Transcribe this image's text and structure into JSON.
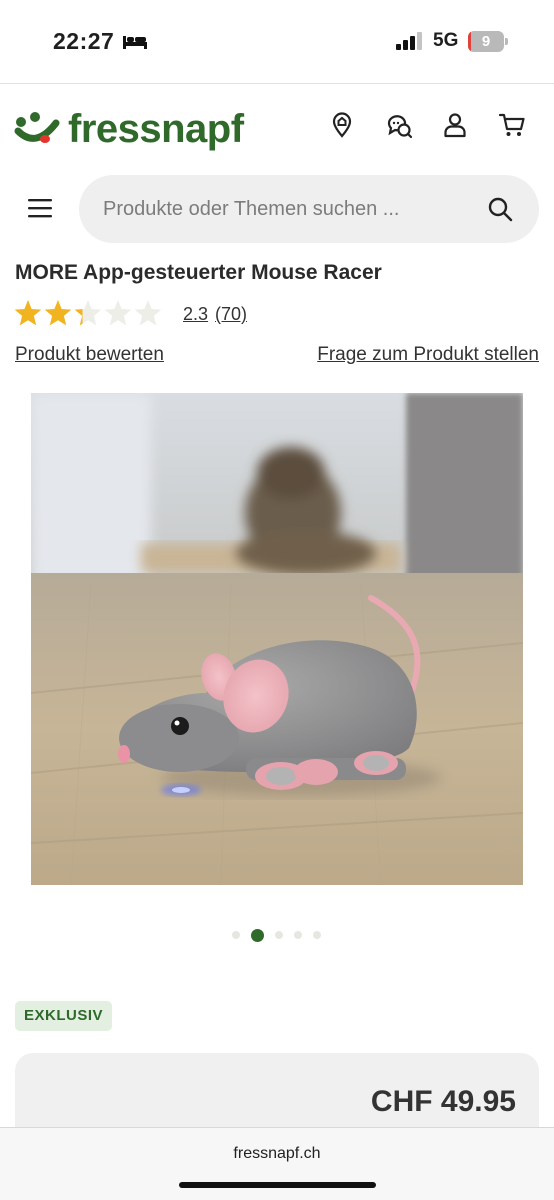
{
  "status_bar": {
    "time": "22:27",
    "network": "5G",
    "battery": "9",
    "battery_level": 0.09
  },
  "header": {
    "logo_text": "fressnapf",
    "icons": [
      "location-pin-icon",
      "chat-support-icon",
      "user-icon",
      "cart-icon"
    ],
    "brand_color": "#2f6a2a"
  },
  "search": {
    "placeholder": "Produkte oder Themen suchen ..."
  },
  "product": {
    "title": "MORE App-gesteuerter Mouse Racer",
    "rating_value": "2.3",
    "rating_count": "(70)",
    "rating_max": 5,
    "rate_link": "Produkt bewerten",
    "question_link": "Frage zum Produkt stellen",
    "image_count": 5,
    "active_image": 2,
    "badge": "EXKLUSIV",
    "price": "CHF 49.95"
  },
  "browser": {
    "url": "fressnapf.ch"
  }
}
